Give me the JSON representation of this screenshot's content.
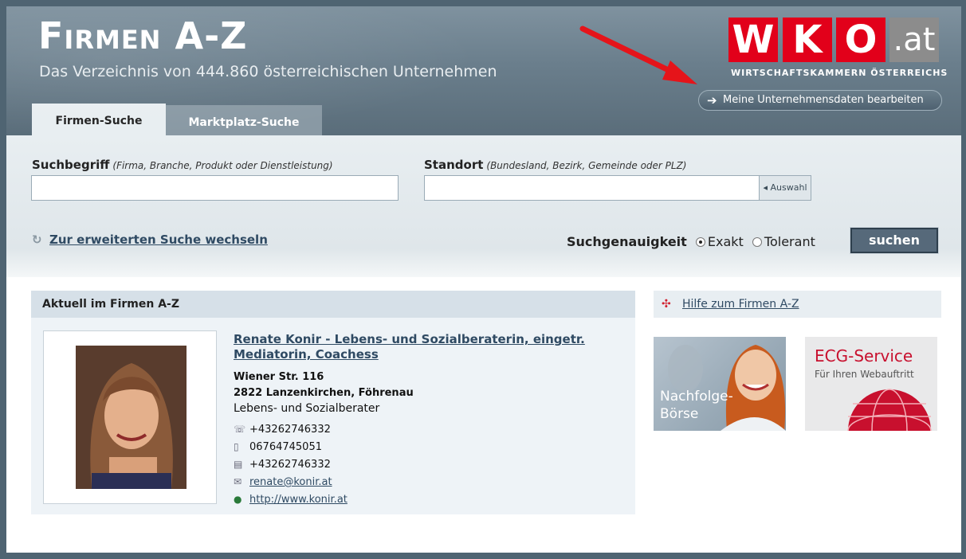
{
  "header": {
    "title": "Firmen A-Z",
    "subtitle": "Das Verzeichnis von 444.860 österreichischen Unternehmen",
    "logo": {
      "letters": [
        "W",
        "K",
        "O"
      ],
      "suffix": ".at",
      "tagline": "WIRTSCHAFTSKAMMERN ÖSTERREICHS"
    },
    "edit_button_label": "Meine Unternehmensdaten bearbeiten",
    "tabs": [
      {
        "label": "Firmen-Suche",
        "active": true
      },
      {
        "label": "Marktplatz-Suche",
        "active": false
      }
    ]
  },
  "search": {
    "term_label": "Suchbegriff",
    "term_hint": "(Firma, Branche, Produkt oder Dienstleistung)",
    "term_value": "",
    "location_label": "Standort",
    "location_hint": "(Bundesland, Bezirk, Gemeinde oder PLZ)",
    "location_value": "",
    "auswahl_label": "◂ Auswahl",
    "advanced_link": "Zur erweiterten Suche wechseln",
    "precision_label": "Suchgenauigkeit",
    "precision_options": [
      {
        "label": "Exakt",
        "checked": true
      },
      {
        "label": "Tolerant",
        "checked": false
      }
    ],
    "submit_label": "suchen"
  },
  "current": {
    "heading": "Aktuell im Firmen A-Z",
    "company_name": "Renate Konir - Lebens- und Sozialberaterin, eingetr. Mediatorin, Coachess",
    "street": "Wiener Str. 116",
    "city": "2822 Lanzenkirchen, Föhrenau",
    "category": "Lebens- und Sozialberater",
    "phone": "+43262746332",
    "mobile": "06764745051",
    "fax": "+43262746332",
    "email": "renate@konir.at",
    "website": "http://www.konir.at"
  },
  "sidebar": {
    "help_link": "Hilfe zum Firmen A-Z",
    "banner_nachfolge": "Nachfolge-\nBörse",
    "banner_ecg_title": "ECG-Service",
    "banner_ecg_subtitle": "Für Ihren Webauftritt"
  },
  "colors": {
    "accent_red": "#e2001a",
    "link": "#2f4a63",
    "header": "#6a7e8c"
  }
}
